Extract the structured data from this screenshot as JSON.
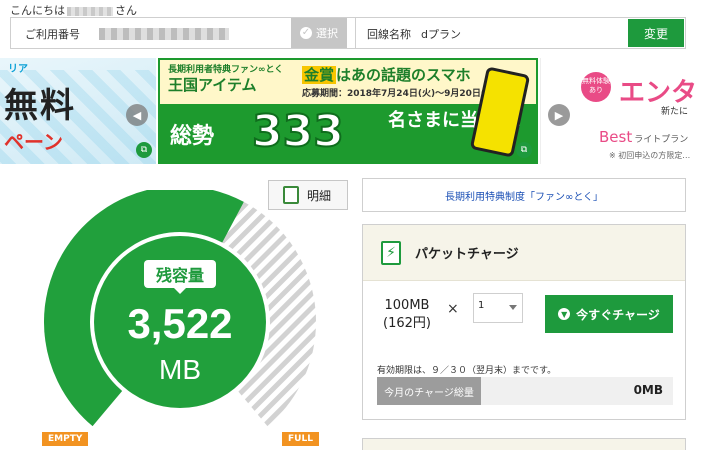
{
  "header": {
    "greeting_prefix": "こんにちは",
    "greeting_suffix": "さん",
    "line_label": "ご利用番号",
    "select_label": "選択",
    "plan_label": "回線名称",
    "plan_value": "dプラン",
    "change_label": "変更"
  },
  "banners": {
    "left": {
      "tag": "リア",
      "headline": "無料",
      "sub": "ペーン"
    },
    "center": {
      "small": "長期利用者特典ファン∞とく",
      "kingdom": "王国アイテム",
      "prize_word": "金賞",
      "prize_rest": "はあの話題のスマホ",
      "period": "応募期間：2018年7月24日(火)〜9月20日(木)",
      "lead": "総勢",
      "count": "333",
      "tail": "名さまに当たる!"
    },
    "right": {
      "badge": "無料体験あり",
      "headline": "エンタ",
      "sub": "新たに",
      "brand": "Best",
      "brand_sub": "ライトプラン",
      "note": "※ 初回申込の方限定…"
    }
  },
  "detail_button": {
    "label": "明細"
  },
  "gauge": {
    "remain_label": "残容量",
    "value": "3,522",
    "unit": "MB",
    "empty_label": "EMPTY",
    "full_label": "FULL",
    "remaining_fraction": 0.6,
    "colors": {
      "fill": "#21a03c",
      "track": "#d2d2d2"
    }
  },
  "fan_link": {
    "label": "長期利用特典制度「ファン∞とく」"
  },
  "charge": {
    "title": "パケットチャージ",
    "plan_size": "100MB",
    "plan_price": "(162円)",
    "times": "×",
    "quantity": "1",
    "button_label": "今すぐチャージ",
    "expiry": "有効期限は、９／３０（翌月末）までです。",
    "monthly_label": "今月のチャージ総量",
    "monthly_value": "0MB"
  }
}
